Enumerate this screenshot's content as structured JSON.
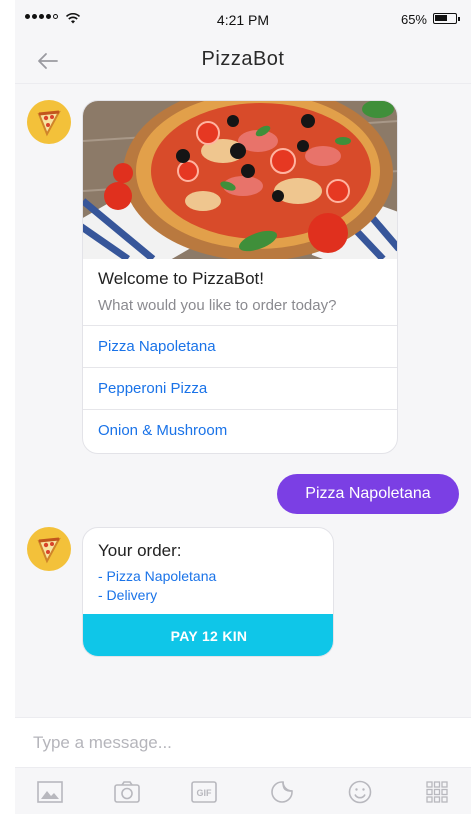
{
  "status_bar": {
    "time": "4:21 PM",
    "battery_percent": "65%",
    "battery_level": 0.65
  },
  "nav": {
    "title": "PizzaBot"
  },
  "welcome_card": {
    "title": "Welcome to PizzaBot!",
    "subtitle": "What would you like to order today?",
    "options": [
      "Pizza Napoletana",
      "Pepperoni Pizza",
      "Onion & Mushroom"
    ]
  },
  "user_message": "Pizza Napoletana",
  "order_card": {
    "title": "Your order:",
    "items": [
      "- Pizza Napoletana",
      "- Delivery"
    ],
    "pay_label": "PAY 12 KIN"
  },
  "input": {
    "placeholder": "Type a message..."
  },
  "toolbar": {
    "icons": [
      "image-icon",
      "camera-icon",
      "gif-icon",
      "sticker-icon",
      "emoji-icon",
      "grid-icon"
    ],
    "gif_label": "GIF"
  },
  "colors": {
    "accent": "#7b3fe4",
    "link": "#1a73e8",
    "pay": "#0fc6e8",
    "avatar": "#f3c13a"
  }
}
